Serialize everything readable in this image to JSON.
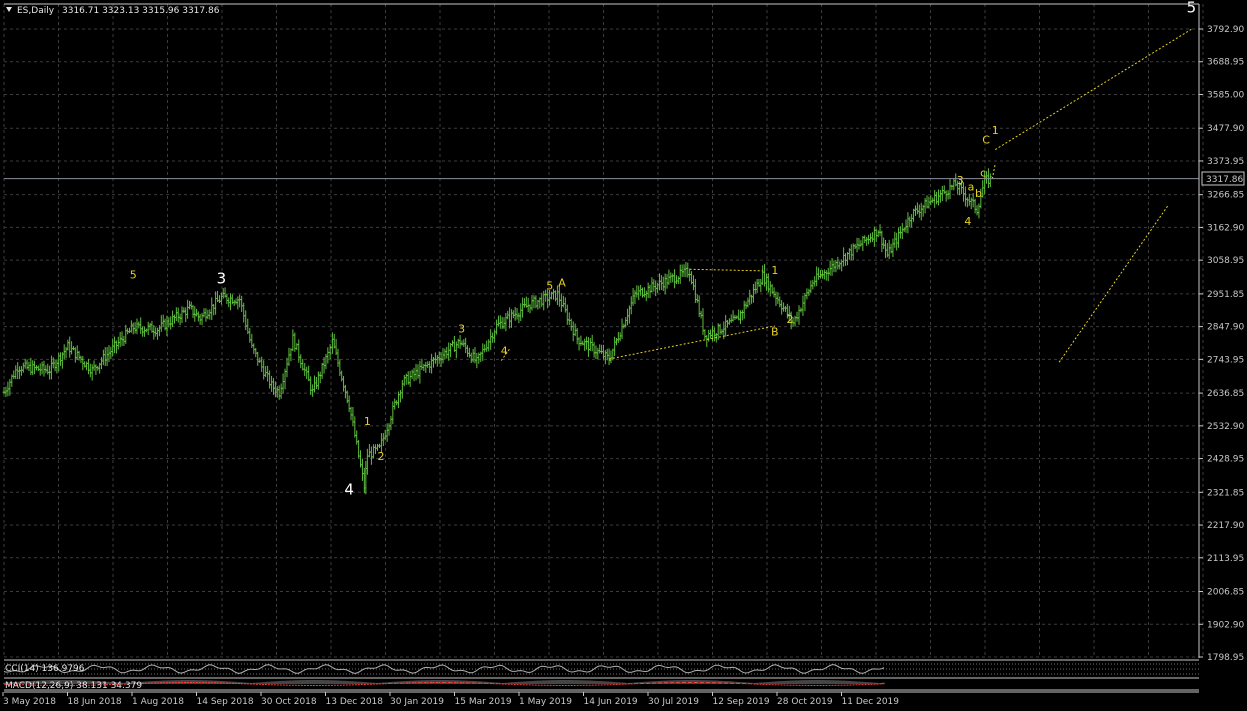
{
  "header": {
    "symbol": "ES,Daily",
    "ohlc": "3316.71 3323.13 3315.96 3317.86"
  },
  "price_axis": {
    "ticks": [
      "3792.90",
      "3688.95",
      "3585.00",
      "3477.90",
      "3373.95",
      "3266.85",
      "3162.90",
      "3058.95",
      "2951.85",
      "2847.90",
      "2743.95",
      "2636.85",
      "2532.90",
      "2428.95",
      "2321.85",
      "2217.90",
      "2113.95",
      "2006.85",
      "1902.90",
      "1798.95"
    ],
    "current_label": "3317.86"
  },
  "time_axis": {
    "labels": [
      "3 May 2018",
      "18 Jun 2018",
      "1 Aug 2018",
      "14 Sep 2018",
      "30 Oct 2018",
      "13 Dec 2018",
      "30 Jan 2019",
      "15 Mar 2019",
      "1 May 2019",
      "14 Jun 2019",
      "30 Jul 2019",
      "12 Sep 2019",
      "28 Oct 2019",
      "11 Dec 2019"
    ]
  },
  "indicators": {
    "cci_label": "CCI(14) 136.9796",
    "macd_label": "MACD(12,26,9) 38.131 34.379"
  },
  "colors": {
    "background": "#000000",
    "grid": "#3c3c3c",
    "bars": "#5fbf3f",
    "wave_primary": "#ffffff",
    "wave_minor": "#e6d21e",
    "trendline": "#e6d21e",
    "axis_text": "#c8c8c8"
  },
  "chart_data": {
    "type": "bar",
    "title": "ES,Daily",
    "ylim": [
      1798.95,
      3830
    ],
    "x_range": [
      "2018-05-01",
      "2020-06-25"
    ],
    "grid": true,
    "price_path": [
      [
        "2018-05-01",
        2640
      ],
      [
        "2018-05-10",
        2720
      ],
      [
        "2018-05-31",
        2710
      ],
      [
        "2018-06-12",
        2785
      ],
      [
        "2018-06-28",
        2710
      ],
      [
        "2018-07-25",
        2845
      ],
      [
        "2018-08-10",
        2840
      ],
      [
        "2018-08-31",
        2905
      ],
      [
        "2018-09-07",
        2875
      ],
      [
        "2018-09-21",
        2940
      ],
      [
        "2018-10-03",
        2935
      ],
      [
        "2018-10-11",
        2780
      ],
      [
        "2018-10-24",
        2660
      ],
      [
        "2018-10-29",
        2640
      ],
      [
        "2018-11-07",
        2810
      ],
      [
        "2018-11-20",
        2640
      ],
      [
        "2018-11-30",
        2760
      ],
      [
        "2018-12-03",
        2800
      ],
      [
        "2018-12-14",
        2600
      ],
      [
        "2018-12-24",
        2340
      ],
      [
        "2018-12-26",
        2440
      ],
      [
        "2019-01-03",
        2460
      ],
      [
        "2019-01-18",
        2670
      ],
      [
        "2019-02-05",
        2730
      ],
      [
        "2019-02-25",
        2800
      ],
      [
        "2019-03-08",
        2735
      ],
      [
        "2019-03-21",
        2850
      ],
      [
        "2019-04-12",
        2920
      ],
      [
        "2019-04-30",
        2950
      ],
      [
        "2019-05-13",
        2810
      ],
      [
        "2019-06-03",
        2745
      ],
      [
        "2019-06-20",
        2950
      ],
      [
        "2019-07-26",
        3025
      ],
      [
        "2019-08-05",
        2820
      ],
      [
        "2019-08-15",
        2840
      ],
      [
        "2019-08-26",
        2870
      ],
      [
        "2019-09-12",
        3010
      ],
      [
        "2019-10-02",
        2860
      ],
      [
        "2019-10-15",
        2990
      ],
      [
        "2019-11-27",
        3155
      ],
      [
        "2019-12-03",
        3075
      ],
      [
        "2019-12-19",
        3205
      ],
      [
        "2020-01-17",
        3300
      ],
      [
        "2020-01-31",
        3220
      ],
      [
        "2020-02-05",
        3310
      ],
      [
        "2020-02-10",
        3317.86
      ]
    ],
    "wave_labels": [
      {
        "text": "3",
        "x": "2018-09-21",
        "y": 2985,
        "level": "primary"
      },
      {
        "text": "4",
        "x": "2018-12-14",
        "y": 2315,
        "level": "primary"
      },
      {
        "text": "5",
        "x": "2020-06-20",
        "y": 3845,
        "level": "primary"
      },
      {
        "text": "5",
        "x": "2018-07-25",
        "y": 3000,
        "level": "minor"
      },
      {
        "text": "1",
        "x": "2018-12-26",
        "y": 2535,
        "level": "minor"
      },
      {
        "text": "2",
        "x": "2019-01-04",
        "y": 2425,
        "level": "minor"
      },
      {
        "text": "3",
        "x": "2019-02-26",
        "y": 2830,
        "level": "minor"
      },
      {
        "text": "4",
        "x": "2019-03-26",
        "y": 2760,
        "level": "minor"
      },
      {
        "text": "5",
        "x": "2019-04-25",
        "y": 2965,
        "level": "minor"
      },
      {
        "text": "A",
        "x": "2019-05-03",
        "y": 2975,
        "level": "minor"
      },
      {
        "text": "1",
        "x": "2019-09-20",
        "y": 3015,
        "level": "minor"
      },
      {
        "text": "2",
        "x": "2019-09-30",
        "y": 2860,
        "level": "minor"
      },
      {
        "text": "B",
        "x": "2019-09-20",
        "y": 2820,
        "level": "minor"
      },
      {
        "text": "3",
        "x": "2020-01-20",
        "y": 3300,
        "level": "minor"
      },
      {
        "text": "4",
        "x": "2020-01-25",
        "y": 3170,
        "level": "minor"
      },
      {
        "text": "a",
        "x": "2020-01-27",
        "y": 3280,
        "level": "minor"
      },
      {
        "text": "b",
        "x": "2020-02-01",
        "y": 3260,
        "level": "minor"
      },
      {
        "text": "c",
        "x": "2020-02-04",
        "y": 3325,
        "level": "minor"
      },
      {
        "text": "C",
        "x": "2020-02-06",
        "y": 3430,
        "level": "minor"
      },
      {
        "text": "1",
        "x": "2020-02-12",
        "y": 3460,
        "level": "minor"
      }
    ],
    "trendlines": [
      [
        [
          "2019-03-24",
          2740
        ],
        [
          "2019-03-30",
          2780
        ]
      ],
      [
        [
          "2019-06-03",
          2745
        ],
        [
          "2019-09-20",
          2850
        ]
      ],
      [
        [
          "2019-07-26",
          3030
        ],
        [
          "2019-09-12",
          3025
        ]
      ],
      [
        [
          "2020-02-12",
          3410
        ],
        [
          "2020-06-21",
          3795
        ]
      ],
      [
        [
          "2020-03-25",
          2735
        ],
        [
          "2020-06-05",
          3235
        ]
      ],
      [
        [
          "2020-02-10",
          3317
        ],
        [
          "2020-02-12",
          3365
        ]
      ]
    ]
  }
}
